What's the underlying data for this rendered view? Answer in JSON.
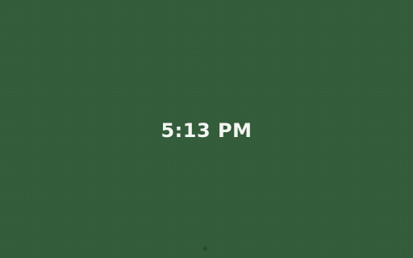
{
  "screen": {
    "time": "5:13 PM",
    "background_color": "#335c3a",
    "text_color": "#f4f6f2"
  },
  "footer": {
    "indicator_icon": "dot-icon"
  }
}
